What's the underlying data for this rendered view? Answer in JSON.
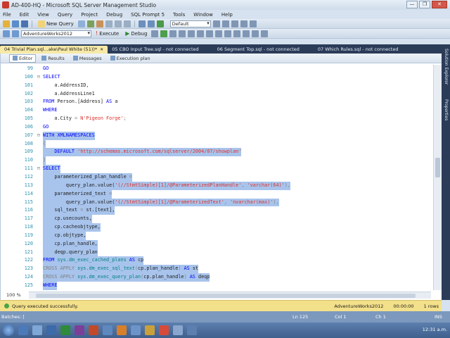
{
  "window": {
    "title": "AD-400-HQ - Microsoft SQL Server Management Studio",
    "buttons": [
      "—",
      "❐",
      "✕"
    ]
  },
  "menu": [
    "File",
    "Edit",
    "View",
    "Query",
    "Project",
    "Debug",
    "SQL Prompt 5",
    "Tools",
    "Window",
    "Help"
  ],
  "toolbar": {
    "new_query": "New Query",
    "config_combo": "Default",
    "database_combo": "AdventureWorks2012",
    "execute": "Execute",
    "debug": "Debug"
  },
  "doc_tabs": [
    {
      "label": "04 Trivial Plan.sql...ake\\Paul White (51))*",
      "active": true,
      "close": "✕"
    },
    {
      "label": "05 CBO Input Tree.sql - not connected",
      "active": false
    },
    {
      "label": "06 Segment Top.sql - not connected",
      "active": false
    },
    {
      "label": "07 Which Rules.sql - not connected",
      "active": false
    }
  ],
  "sub_tabs": [
    {
      "label": "Editor",
      "active": true
    },
    {
      "label": "Results",
      "active": false
    },
    {
      "label": "Messages",
      "active": false
    },
    {
      "label": "Execution plan",
      "active": false
    }
  ],
  "code_lines": [
    {
      "n": "99",
      "g": "",
      "sel": false,
      "parts": [
        [
          "kw",
          "GO"
        ]
      ]
    },
    {
      "n": "100",
      "g": "⊟",
      "sel": false,
      "parts": [
        [
          "kw",
          "SELECT"
        ]
      ]
    },
    {
      "n": "101",
      "g": "",
      "sel": false,
      "parts": [
        [
          "tx",
          "    a.AddressID,"
        ]
      ]
    },
    {
      "n": "102",
      "g": "",
      "sel": false,
      "parts": [
        [
          "tx",
          "    a.AddressLine1"
        ]
      ]
    },
    {
      "n": "103",
      "g": "",
      "sel": false,
      "parts": [
        [
          "kw",
          "FROM "
        ],
        [
          "tx",
          "Person.[Address] "
        ],
        [
          "kw",
          "AS "
        ],
        [
          "tx",
          "a"
        ]
      ]
    },
    {
      "n": "104",
      "g": "",
      "sel": false,
      "parts": [
        [
          "kw",
          "WHERE"
        ]
      ]
    },
    {
      "n": "105",
      "g": "",
      "sel": false,
      "parts": [
        [
          "tx",
          "    a.City "
        ],
        [
          "gr",
          "= "
        ],
        [
          "str",
          "N'Pigeon Forge'"
        ],
        [
          "gr",
          ";"
        ]
      ]
    },
    {
      "n": "106",
      "g": "",
      "sel": false,
      "parts": [
        [
          "kw",
          "GO"
        ]
      ]
    },
    {
      "n": "107",
      "g": "⊟",
      "sel": true,
      "parts": [
        [
          "kw",
          "WITH XMLNAMESPACES"
        ]
      ]
    },
    {
      "n": "108",
      "g": "",
      "sel": true,
      "parts": [
        [
          "gr",
          "("
        ]
      ]
    },
    {
      "n": "109",
      "g": "",
      "sel": true,
      "parts": [
        [
          "kw",
          "    DEFAULT "
        ],
        [
          "str",
          "'http://schemas.microsoft.com/sqlserver/2004/07/showplan'"
        ]
      ]
    },
    {
      "n": "110",
      "g": "",
      "sel": true,
      "parts": [
        [
          "gr",
          ")"
        ]
      ]
    },
    {
      "n": "111",
      "g": "⊟",
      "sel": true,
      "parts": [
        [
          "kw",
          "SELECT"
        ]
      ]
    },
    {
      "n": "112",
      "g": "",
      "sel": true,
      "parts": [
        [
          "tx",
          "    parameterized_plan_handle "
        ],
        [
          "gr",
          "="
        ]
      ]
    },
    {
      "n": "113",
      "g": "",
      "sel": true,
      "parts": [
        [
          "tx",
          "        query_plan.value("
        ],
        [
          "str",
          "'(//StmtSimple)[1]/@ParameterizedPlanHandle'"
        ],
        [
          "gr",
          ", "
        ],
        [
          "str",
          "'varchar(64)'"
        ],
        [
          "gr",
          "),"
        ]
      ]
    },
    {
      "n": "114",
      "g": "",
      "sel": true,
      "parts": [
        [
          "tx",
          "    parameterized_text "
        ],
        [
          "gr",
          "="
        ]
      ]
    },
    {
      "n": "115",
      "g": "",
      "sel": true,
      "parts": [
        [
          "tx",
          "        query_plan.value("
        ],
        [
          "str",
          "'(//StmtSimple)[1]/@ParameterizedText'"
        ],
        [
          "gr",
          ", "
        ],
        [
          "str",
          "'nvarchar(max)'"
        ],
        [
          "gr",
          "),"
        ]
      ]
    },
    {
      "n": "116",
      "g": "",
      "sel": true,
      "parts": [
        [
          "tx",
          "    sql_text "
        ],
        [
          "gr",
          "= "
        ],
        [
          "tx",
          "st.[text],"
        ]
      ]
    },
    {
      "n": "117",
      "g": "",
      "sel": true,
      "parts": [
        [
          "tx",
          "    cp.usecounts,"
        ]
      ]
    },
    {
      "n": "118",
      "g": "",
      "sel": true,
      "parts": [
        [
          "tx",
          "    cp.cacheobjtype,"
        ]
      ]
    },
    {
      "n": "119",
      "g": "",
      "sel": true,
      "parts": [
        [
          "tx",
          "    cp.objtype,"
        ]
      ]
    },
    {
      "n": "120",
      "g": "",
      "sel": true,
      "parts": [
        [
          "tx",
          "    cp.plan_handle,"
        ]
      ]
    },
    {
      "n": "121",
      "g": "",
      "sel": true,
      "parts": [
        [
          "tx",
          "    deqp.query_plan"
        ]
      ]
    },
    {
      "n": "122",
      "g": "",
      "sel": true,
      "parts": [
        [
          "kw",
          "FROM "
        ],
        [
          "obj",
          "sys.dm_exec_cached_plans "
        ],
        [
          "kw",
          "AS "
        ],
        [
          "tx",
          "cp"
        ]
      ]
    },
    {
      "n": "123",
      "g": "",
      "sel": true,
      "parts": [
        [
          "gr",
          "CROSS APPLY "
        ],
        [
          "obj",
          "sys.dm_exec_sql_text"
        ],
        [
          "gr",
          "("
        ],
        [
          "tx",
          "cp.plan_handle"
        ],
        [
          "gr",
          ") "
        ],
        [
          "kw",
          "AS "
        ],
        [
          "tx",
          "st"
        ]
      ]
    },
    {
      "n": "124",
      "g": "",
      "sel": true,
      "parts": [
        [
          "gr",
          "CROSS APPLY "
        ],
        [
          "obj",
          "sys.dm_exec_query_plan"
        ],
        [
          "gr",
          "("
        ],
        [
          "tx",
          "cp.plan_handle"
        ],
        [
          "gr",
          ") "
        ],
        [
          "kw",
          "AS "
        ],
        [
          "tx",
          "deqp"
        ]
      ]
    },
    {
      "n": "125",
      "g": "",
      "sel": true,
      "parts": [
        [
          "kw",
          "WHERE"
        ]
      ]
    }
  ],
  "zoom": "100 %",
  "right_panel": [
    "Solution Explorer",
    "Properties"
  ],
  "status": {
    "message": "Query executed successfully.",
    "database": "AdventureWorks2012",
    "time": "00:00:00",
    "rows": "1 rows"
  },
  "app_status": {
    "left": "Batches: [",
    "ln": "Ln 125",
    "col": "Col 1",
    "ch": "Ch 1",
    "ins": "INS"
  },
  "tray": "12:31 a.m.",
  "colors": {
    "selection": "#a8c4ec",
    "keyword": "#0000ff",
    "string": "#e0302b",
    "status_bar": "#f3e08a"
  }
}
